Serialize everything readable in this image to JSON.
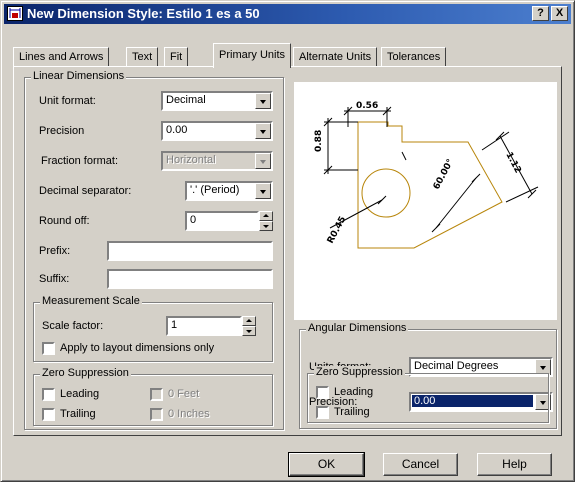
{
  "window": {
    "title": "New Dimension Style: Estilo 1 es a 50",
    "help_btn": "?",
    "close_btn": "X"
  },
  "tabs": [
    {
      "label": "Lines and Arrows"
    },
    {
      "label": "Text"
    },
    {
      "label": "Fit"
    },
    {
      "label": "Primary Units"
    },
    {
      "label": "Alternate Units"
    },
    {
      "label": "Tolerances"
    }
  ],
  "linear": {
    "title": "Linear Dimensions",
    "unit_format_label": "Unit format:",
    "unit_format_value": "Decimal",
    "precision_label": "Precision",
    "precision_value": "0.00",
    "fraction_format_label": "Fraction format:",
    "fraction_format_value": "Horizontal",
    "decimal_sep_label": "Decimal separator:",
    "decimal_sep_value": "'.' (Period)",
    "round_off_label": "Round off:",
    "round_off_value": "0",
    "prefix_label": "Prefix:",
    "prefix_value": "",
    "suffix_label": "Suffix:",
    "suffix_value": ""
  },
  "measurement": {
    "title": "Measurement Scale",
    "scale_label": "Scale factor:",
    "scale_value": "1",
    "layout_only_label": "Apply to layout dimensions only"
  },
  "zero_linear": {
    "title": "Zero Suppression",
    "leading": "Leading",
    "trailing": "Trailing",
    "feet": "0 Feet",
    "inches": "0 Inches"
  },
  "preview": {
    "dim_top": "0.56",
    "dim_left": "0.88",
    "dim_right": "1.12",
    "dim_angle": "60.00°",
    "dim_radius": "R0.45",
    "line_color": "#b8860b"
  },
  "angular": {
    "title": "Angular Dimensions",
    "units_format_label": "Units format:",
    "units_format_value": "Decimal Degrees",
    "precision_label": "Precision:",
    "precision_value": "0.00"
  },
  "zero_angular": {
    "title": "Zero Suppression",
    "leading": "Leading",
    "trailing": "Trailing"
  },
  "buttons": {
    "ok": "OK",
    "cancel": "Cancel",
    "help": "Help"
  }
}
